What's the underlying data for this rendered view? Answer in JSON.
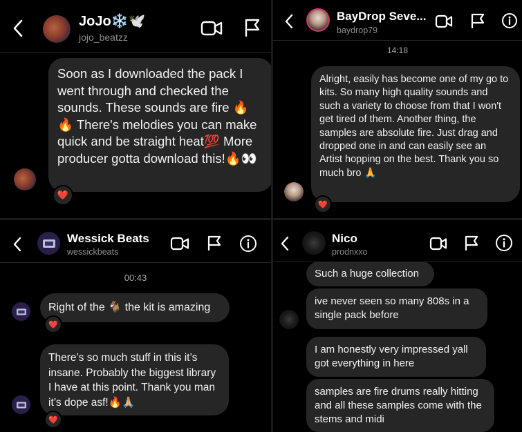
{
  "colors": {
    "background": "#000000",
    "bubble": "#262626",
    "heart": "#ed2c43",
    "secondary_text": "#8e8e8e"
  },
  "panel1": {
    "name": "JoJo❄️🕊️",
    "handle": "jojo_beatzz",
    "message": "Soon as I downloaded the pack I went through and checked the sounds. These sounds are fire 🔥 🔥  There's melodies you can make quick and be straight heat💯  More producer gotta download this!🔥👀",
    "reaction": "❤️",
    "icons": [
      "back-chevron-icon",
      "video-call-icon",
      "flag-icon"
    ]
  },
  "panel2": {
    "name": "BayDrop Seve...",
    "handle": "baydrop79",
    "time": "14:18",
    "message": "Alright, easily has become one of my go to kits. So many high quality sounds and such a variety to choose from that I won't get tired of them. Another thing, the samples are absolute fire. Just drag and dropped one in and can easily see an Artist hopping on the best. Thank you so much bro 🙏",
    "reaction": "❤️",
    "icons": [
      "back-chevron-icon",
      "video-call-icon",
      "flag-icon",
      "info-icon"
    ]
  },
  "panel3": {
    "name": "Wessick Beats",
    "handle": "wessickbeats",
    "time": "00:43",
    "message1": "Right of the 🐐 the kit is amazing",
    "message2": "There’s so much stuff in this it’s insane. Probably the biggest library I have at this point. Thank you man it’s dope asf!🔥🙏🏼",
    "reaction": "❤️",
    "icons": [
      "back-chevron-icon",
      "video-call-icon",
      "flag-icon",
      "info-icon"
    ]
  },
  "panel4": {
    "name": "Nico",
    "handle": "prodnxxo",
    "messages": [
      "Such a huge collection",
      "ive never seen so many 808s in a single pack before",
      "I am honestly very impressed yall got everything in here",
      "samples are fire drums really hitting and all these samples come with the stems and midi"
    ],
    "icons": [
      "back-chevron-icon",
      "video-call-icon",
      "flag-icon",
      "info-icon"
    ]
  }
}
